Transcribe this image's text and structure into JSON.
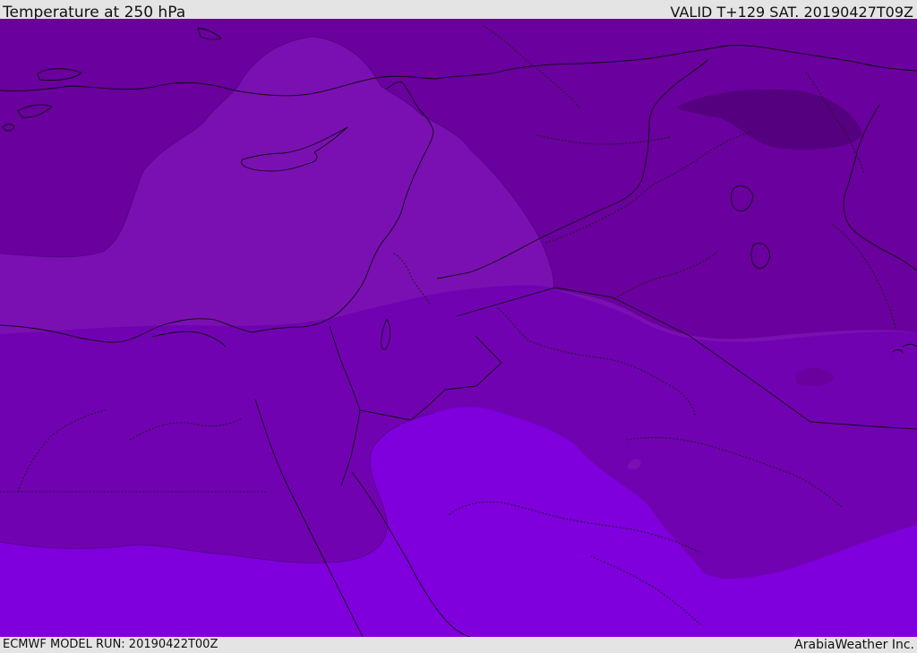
{
  "header": {
    "title": "Temperature at 250 hPa",
    "valid_time": "VALID T+129 SAT. 20190427T09Z"
  },
  "footer": {
    "model_run": "ECMWF MODEL RUN: 20190422T00Z",
    "credit": "ArabiaWeather Inc."
  },
  "map": {
    "colors": {
      "cold_band_darkest": "#55007f",
      "cold_band_dark": "#6a009d",
      "band_mid": "#7a10b2",
      "band_light": "#7000b0",
      "warm_band_bright": "#7f00dd",
      "coastline": "#0b0b0b"
    }
  }
}
